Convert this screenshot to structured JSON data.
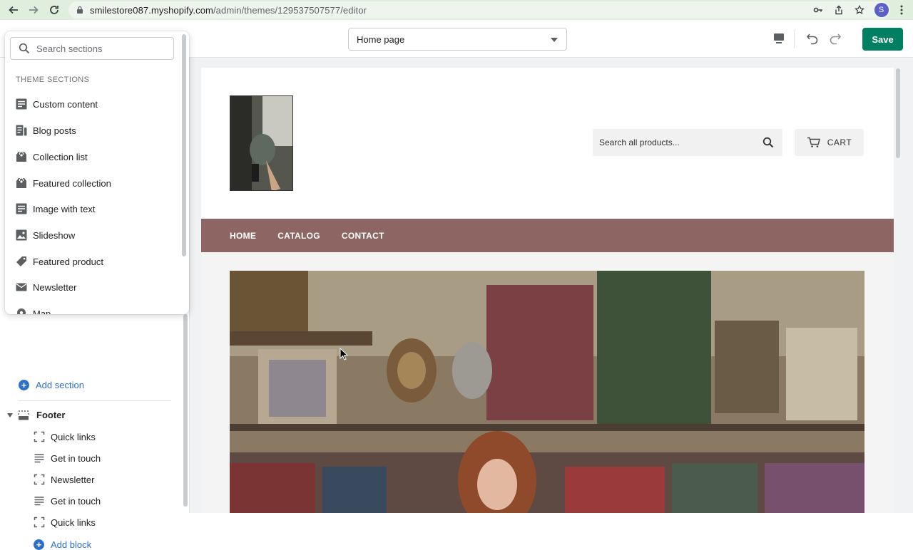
{
  "browser": {
    "url_domain": "smilestore087.myshopify.com",
    "url_path": "/admin/themes/129537507577/editor",
    "profile_initial": "S"
  },
  "editor": {
    "page_select_value": "Home page",
    "save_label": "Save"
  },
  "section_picker": {
    "search_placeholder": "Search sections",
    "heading": "THEME SECTIONS",
    "items": [
      {
        "label": "Custom content",
        "icon": "text-block-icon"
      },
      {
        "label": "Blog posts",
        "icon": "blog-icon"
      },
      {
        "label": "Collection list",
        "icon": "collection-tag-icon"
      },
      {
        "label": "Featured collection",
        "icon": "collection-tag-icon"
      },
      {
        "label": "Image with text",
        "icon": "text-block-icon"
      },
      {
        "label": "Slideshow",
        "icon": "image-icon"
      },
      {
        "label": "Featured product",
        "icon": "product-tag-icon"
      },
      {
        "label": "Newsletter",
        "icon": "envelope-icon"
      },
      {
        "label": "Map",
        "icon": "map-pin-icon"
      }
    ]
  },
  "sidebar": {
    "add_section_label": "Add section",
    "footer_label": "Footer",
    "footer_blocks": [
      {
        "label": "Quick links",
        "icon": "dashed-square-icon"
      },
      {
        "label": "Get in touch",
        "icon": "lines-icon"
      },
      {
        "label": "Newsletter",
        "icon": "dashed-square-icon"
      },
      {
        "label": "Get in touch",
        "icon": "lines-icon"
      },
      {
        "label": "Quick links",
        "icon": "dashed-square-icon"
      }
    ],
    "add_block_label": "Add block"
  },
  "storefront": {
    "search_placeholder": "Search all products...",
    "cart_label": "CART",
    "nav": [
      "HOME",
      "CATALOG",
      "CONTACT"
    ],
    "nav_color": "#8d6663"
  },
  "colors": {
    "accent": "#008060",
    "link": "#2c6ecb",
    "browser_bar": "#dfeedd"
  }
}
